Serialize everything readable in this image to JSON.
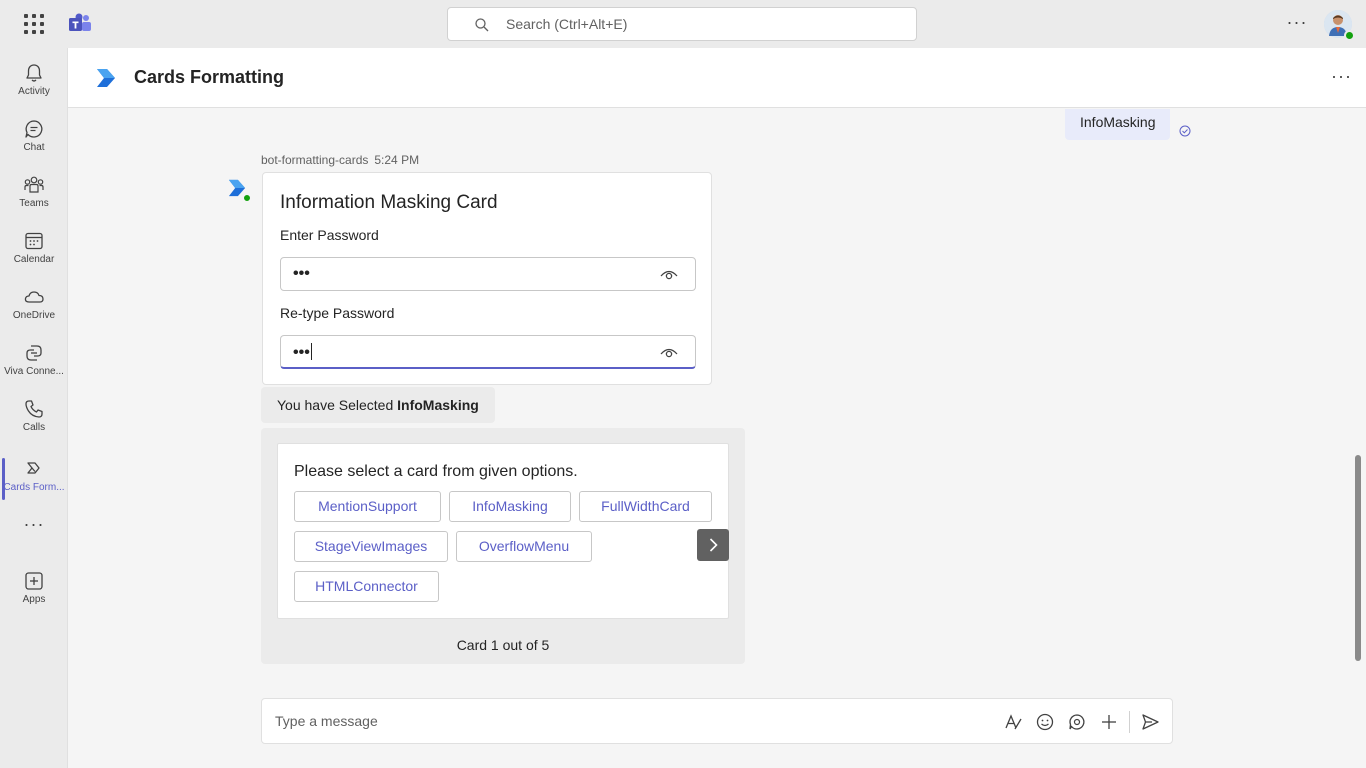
{
  "topbar": {
    "search_placeholder": "Search (Ctrl+Alt+E)",
    "more_label": "···"
  },
  "rail": {
    "items": [
      {
        "label": "Activity",
        "icon": "bell-icon"
      },
      {
        "label": "Chat",
        "icon": "chat-icon"
      },
      {
        "label": "Teams",
        "icon": "teams-icon"
      },
      {
        "label": "Calendar",
        "icon": "calendar-icon"
      },
      {
        "label": "OneDrive",
        "icon": "cloud-icon"
      },
      {
        "label": "Viva Conne...",
        "icon": "viva-icon"
      },
      {
        "label": "Calls",
        "icon": "phone-icon"
      },
      {
        "label": "Cards Form...",
        "icon": "app-icon"
      },
      {
        "label": "Apps",
        "icon": "add-app-icon"
      }
    ],
    "more_label": "···"
  },
  "header": {
    "title": "Cards Formatting",
    "more_label": "···"
  },
  "chat": {
    "sent_message": "InfoMasking",
    "bot_name": "bot-formatting-cards",
    "bot_time": "5:24 PM",
    "masking_card": {
      "title": "Information Masking Card",
      "field1_label": "Enter Password",
      "field1_value": "•••",
      "field2_label": "Re-type Password",
      "field2_value": "•••"
    },
    "selected_prefix": "You have Selected ",
    "selected_value": "InfoMasking",
    "carousel": {
      "title": "Please select a card from given options.",
      "options": [
        "MentionSupport",
        "InfoMasking",
        "FullWidthCard",
        "StageViewImages",
        "OverflowMenu",
        "HTMLConnector"
      ],
      "pager": "Card 1 out of 5"
    }
  },
  "composer": {
    "placeholder": "Type a message"
  },
  "colors": {
    "accent": "#5b5fc7",
    "presence": "#13a10e",
    "app_blue": "#1e6fd9"
  }
}
